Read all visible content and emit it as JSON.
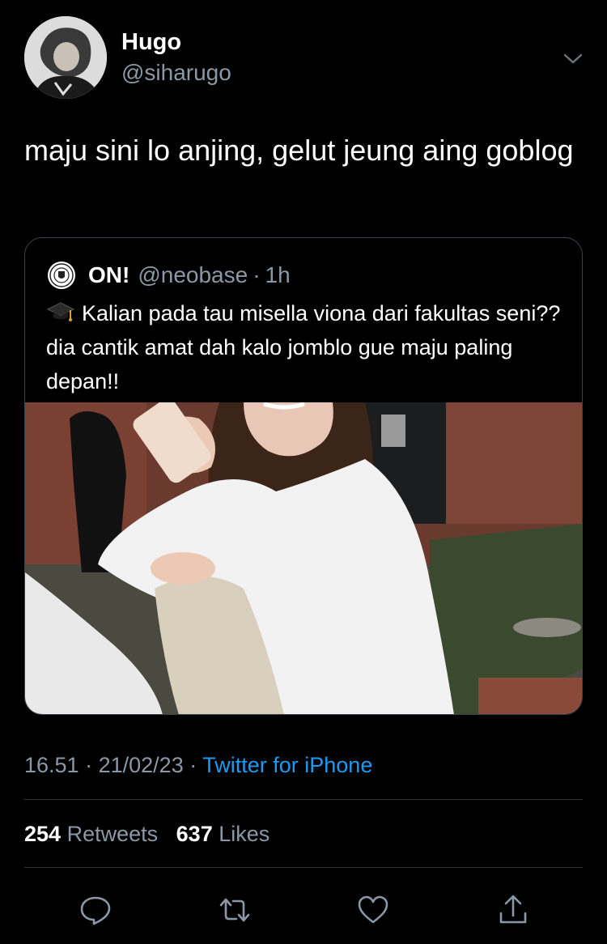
{
  "author": {
    "name": "Hugo",
    "handle": "@siharugo"
  },
  "tweet": {
    "text": "maju sini lo anjing, gelut jeung aing goblog"
  },
  "quoted": {
    "name": "ON!",
    "handle": "@neobase",
    "separator": "·",
    "time": "1h",
    "emoji": "graduation-cap-icon",
    "text": "Kalian pada tau misella viona dari fakultas seni?? dia cantik amat dah kalo jomblo gue maju paling depan!!"
  },
  "meta": {
    "time": "16.51",
    "dot1": "·",
    "date": "21/02/23",
    "dot2": "·",
    "source": "Twitter for iPhone"
  },
  "stats": {
    "retweets_count": "254",
    "retweets_label": "Retweets",
    "likes_count": "637",
    "likes_label": "Likes"
  },
  "colors": {
    "background": "#000000",
    "secondary_text": "#8b98a5",
    "link": "#1d9bf0",
    "divider": "#2f3336"
  }
}
